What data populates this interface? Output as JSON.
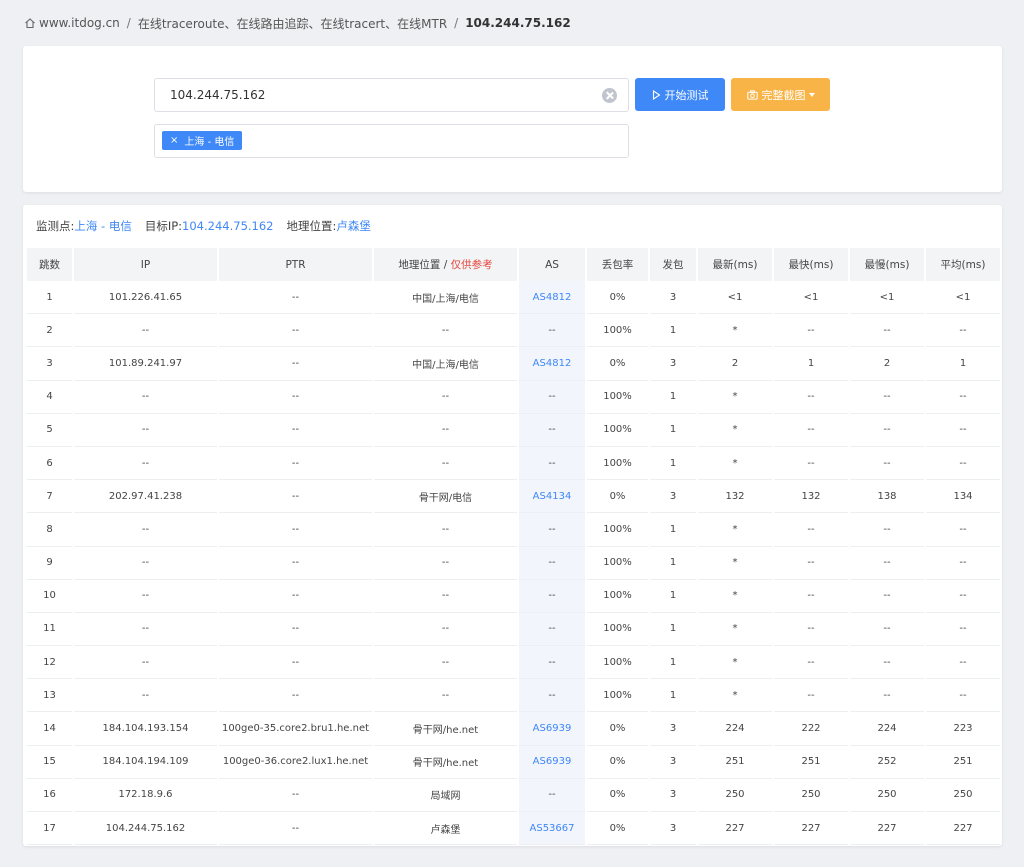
{
  "breadcrumb": {
    "home": "www.itdog.cn",
    "section": "在线traceroute、在线路由追踪、在线tracert、在线MTR",
    "current": "104.244.75.162"
  },
  "search": {
    "value": "104.244.75.162",
    "start_label": "开始测试",
    "screenshot_label": "完整截图"
  },
  "selected_nodes": [
    "上海 - 电信"
  ],
  "monitor": {
    "node_label": "监测点:",
    "node_value": "上海 - 电信",
    "target_label": "目标IP:",
    "target_value": "104.244.75.162",
    "geo_label": "地理位置:",
    "geo_value": "卢森堡"
  },
  "table": {
    "headers": {
      "hop": "跳数",
      "ip": "IP",
      "ptr": "PTR",
      "geo": "地理位置 / ",
      "geo_ref": "仅供参考",
      "as": "AS",
      "loss": "丢包率",
      "sent": "发包",
      "last": "最新(ms)",
      "best": "最快(ms)",
      "worst": "最慢(ms)",
      "avg": "平均(ms)"
    },
    "rows": [
      [
        "1",
        "101.226.41.65",
        "--",
        "中国/上海/电信",
        "AS4812",
        "0%",
        "3",
        "<1",
        "<1",
        "<1",
        "<1"
      ],
      [
        "2",
        "--",
        "--",
        "--",
        "--",
        "100%",
        "1",
        "*",
        "--",
        "--",
        "--"
      ],
      [
        "3",
        "101.89.241.97",
        "--",
        "中国/上海/电信",
        "AS4812",
        "0%",
        "3",
        "2",
        "1",
        "2",
        "1"
      ],
      [
        "4",
        "--",
        "--",
        "--",
        "--",
        "100%",
        "1",
        "*",
        "--",
        "--",
        "--"
      ],
      [
        "5",
        "--",
        "--",
        "--",
        "--",
        "100%",
        "1",
        "*",
        "--",
        "--",
        "--"
      ],
      [
        "6",
        "--",
        "--",
        "--",
        "--",
        "100%",
        "1",
        "*",
        "--",
        "--",
        "--"
      ],
      [
        "7",
        "202.97.41.238",
        "--",
        "骨干网/电信",
        "AS4134",
        "0%",
        "3",
        "132",
        "132",
        "138",
        "134"
      ],
      [
        "8",
        "--",
        "--",
        "--",
        "--",
        "100%",
        "1",
        "*",
        "--",
        "--",
        "--"
      ],
      [
        "9",
        "--",
        "--",
        "--",
        "--",
        "100%",
        "1",
        "*",
        "--",
        "--",
        "--"
      ],
      [
        "10",
        "--",
        "--",
        "--",
        "--",
        "100%",
        "1",
        "*",
        "--",
        "--",
        "--"
      ],
      [
        "11",
        "--",
        "--",
        "--",
        "--",
        "100%",
        "1",
        "*",
        "--",
        "--",
        "--"
      ],
      [
        "12",
        "--",
        "--",
        "--",
        "--",
        "100%",
        "1",
        "*",
        "--",
        "--",
        "--"
      ],
      [
        "13",
        "--",
        "--",
        "--",
        "--",
        "100%",
        "1",
        "*",
        "--",
        "--",
        "--"
      ],
      [
        "14",
        "184.104.193.154",
        "100ge0-35.core2.bru1.he.net",
        "骨干网/he.net",
        "AS6939",
        "0%",
        "3",
        "224",
        "222",
        "224",
        "223"
      ],
      [
        "15",
        "184.104.194.109",
        "100ge0-36.core2.lux1.he.net",
        "骨干网/he.net",
        "AS6939",
        "0%",
        "3",
        "251",
        "251",
        "252",
        "251"
      ],
      [
        "16",
        "172.18.9.6",
        "--",
        "局域网",
        "--",
        "0%",
        "3",
        "250",
        "250",
        "250",
        "250"
      ],
      [
        "17",
        "104.244.75.162",
        "--",
        "卢森堡",
        "AS53667",
        "0%",
        "3",
        "227",
        "227",
        "227",
        "227"
      ]
    ]
  },
  "colors": {
    "primary": "#3f88f7",
    "warning": "#f8b446",
    "danger": "#e6453c"
  }
}
